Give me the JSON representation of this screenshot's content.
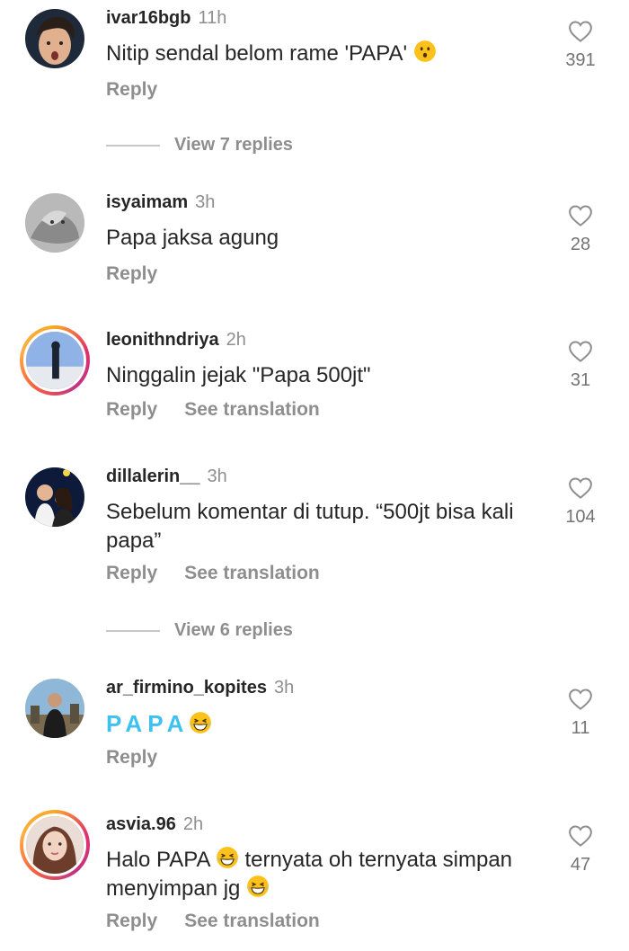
{
  "comments": [
    {
      "username": "ivar16bgb",
      "time": "11h",
      "text": "Nitip sendal belom rame 'PAPA'",
      "likes": "391",
      "reply": "Reply"
    },
    {
      "username": "isyaimam",
      "time": "3h",
      "text": "Papa jaksa agung",
      "likes": "28",
      "reply": "Reply"
    },
    {
      "username": "leonithndriya",
      "time": "2h",
      "text": "Ninggalin jejak \"Papa 500jt\"",
      "likes": "31",
      "reply": "Reply",
      "translate": "See translation"
    },
    {
      "username": "dillalerin__",
      "time": "3h",
      "text_line1": "Sebelum komentar di tutup. “500jt bisa kali",
      "text_line2": "papa”",
      "likes": "104",
      "reply": "Reply",
      "translate": "See translation"
    },
    {
      "username": "ar_firmino_kopites",
      "time": "3h",
      "text": "PAPA",
      "likes": "11",
      "reply": "Reply"
    },
    {
      "username": "asvia.96",
      "time": "2h",
      "text_part1": "Halo PAPA",
      "text_part2": "ternyata oh ternyata simpan",
      "text_line2": "menyimpan jg",
      "likes": "47",
      "reply": "Reply",
      "translate": "See translation"
    }
  ],
  "view_replies": [
    "View 7 replies",
    "View 6 replies"
  ],
  "icons": {
    "like": "heart-outline-icon",
    "emoji_surprised": "hushed-face-emoji",
    "emoji_laugh": "grinning-squinting-face-emoji"
  }
}
